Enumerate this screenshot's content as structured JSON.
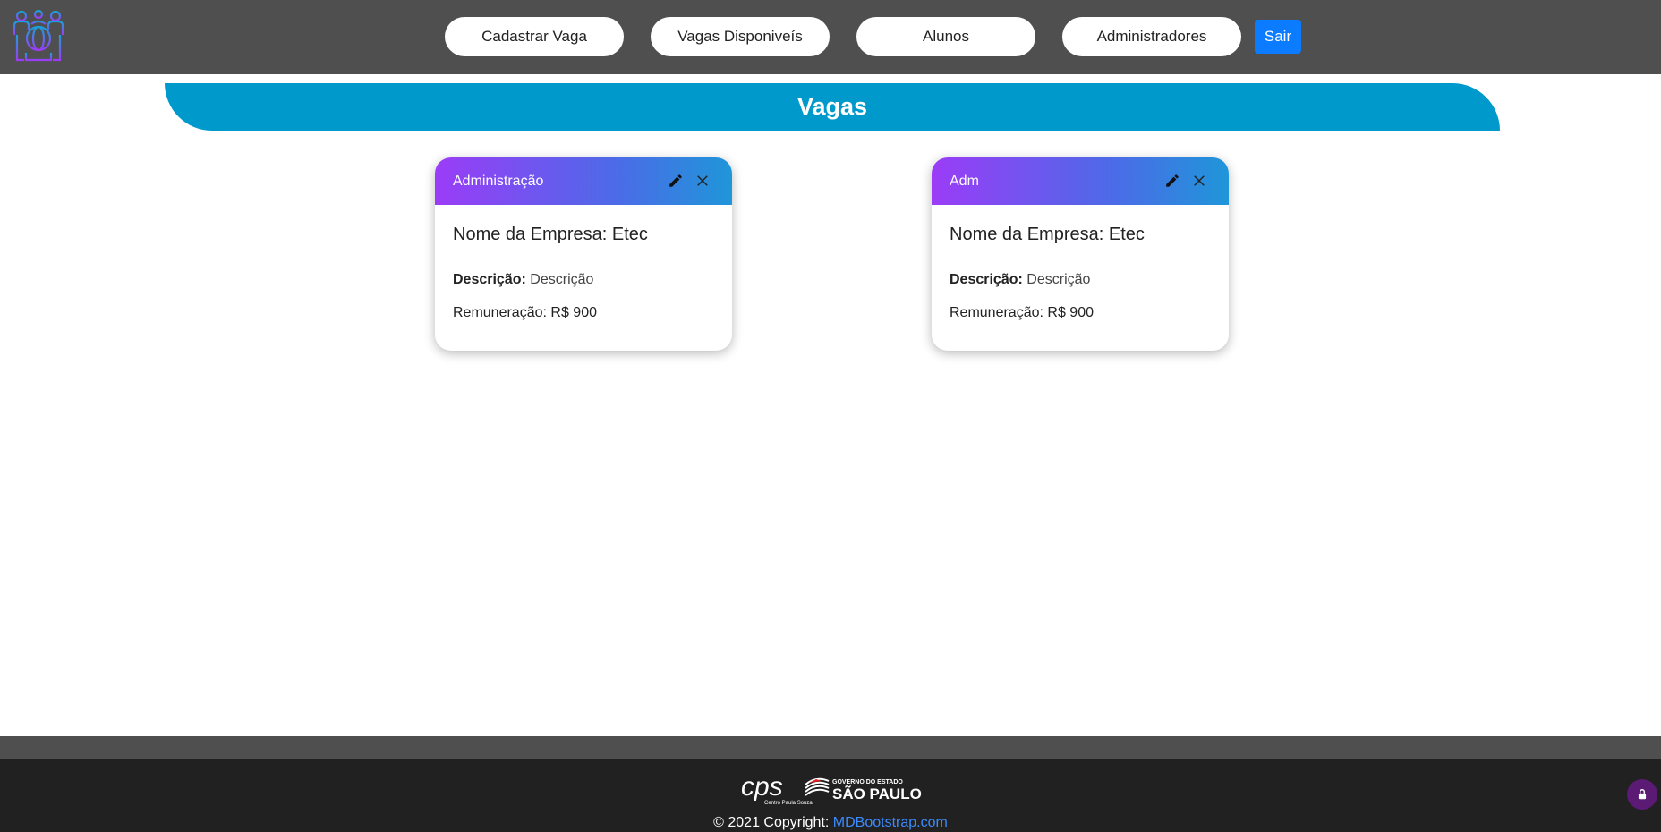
{
  "navbar": {
    "items": [
      {
        "label": "Cadastrar Vaga"
      },
      {
        "label": "Vagas Disponiveís"
      },
      {
        "label": "Alunos"
      },
      {
        "label": "Administradores"
      }
    ],
    "logout_label": "Sair",
    "logout_color": "#0b7cff"
  },
  "banner": {
    "title": "Vagas",
    "color": "#0099cc"
  },
  "cards": [
    {
      "title": "Administração",
      "company": "Nome da Empresa: Etec",
      "description_label": "Descrição:",
      "description_value": "Descrição",
      "salary": "Remuneração: R$ 900"
    },
    {
      "title": "Adm",
      "company": "Nome da Empresa: Etec",
      "description_label": "Descrição:",
      "description_value": "Descrição",
      "salary": "Remuneração: R$ 900"
    }
  ],
  "footer": {
    "logo_1_text": "cps",
    "logo_1_sub": "Centro Paula Souza",
    "logo_2_line1": "GOVERNO DO ESTADO",
    "logo_2_line2": "SÃO PAULO",
    "copyright_prefix": "© 2021 Copyright:",
    "copyright_link": "MDBootstrap.com"
  },
  "icons": {
    "logo": "people-globe-icon",
    "edit": "pencil-icon",
    "delete": "close-icon",
    "lock": "lock-icon"
  }
}
